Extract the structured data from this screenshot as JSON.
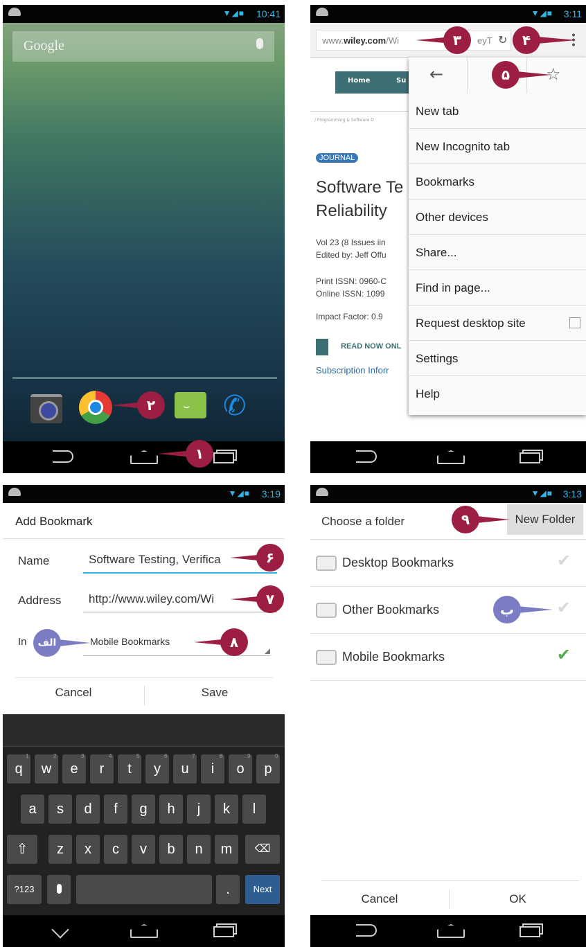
{
  "p1": {
    "time": "10:41",
    "search_label": "Google",
    "dock_icons": [
      "camera-icon",
      "chrome-icon",
      "messaging-icon",
      "phone-icon"
    ],
    "callouts": {
      "c1": "١",
      "c2": "٢"
    }
  },
  "p2": {
    "time": "3:11",
    "url_prefix": "www.",
    "url_domain": "wiley.com",
    "url_rest": "/Wi",
    "url_tail": "eyT",
    "site_nav": [
      "Home",
      "Su"
    ],
    "breadcrumb": "/ Programming & Software D",
    "journal_badge": "JOURNAL",
    "title_line1": "Software Te",
    "title_line2": "Reliability",
    "vol": "Vol 23 (8 Issues iin",
    "edited": "Edited by: Jeff Offu",
    "print_issn": "Print ISSN: 0960-C",
    "online_issn": "Online ISSN: 1099",
    "impact": "Impact Factor: 0.9",
    "read_now": "READ NOW ONL",
    "subscription": "Subscription Inforr",
    "menu": [
      "New tab",
      "New Incognito tab",
      "Bookmarks",
      "Other devices",
      "Share...",
      "Find in page...",
      "Request desktop site",
      "Settings",
      "Help"
    ],
    "callouts": {
      "c3": "٣",
      "c4": "۴",
      "c5": "۵"
    }
  },
  "p3": {
    "time": "3:19",
    "dialog_title": "Add Bookmark",
    "name_label": "Name",
    "name_value": "Software Testing, Verifica",
    "address_label": "Address",
    "address_value": "http://www.wiley.com/Wi",
    "in_label": "In",
    "folder_value": "Mobile Bookmarks",
    "cancel": "Cancel",
    "save": "Save",
    "row1": [
      "q",
      "w",
      "e",
      "r",
      "t",
      "y",
      "u",
      "i",
      "o",
      "p"
    ],
    "row1_hints": [
      "1",
      "2",
      "3",
      "4",
      "5",
      "6",
      "7",
      "8",
      "9",
      "0"
    ],
    "row2": [
      "a",
      "s",
      "d",
      "f",
      "g",
      "h",
      "j",
      "k",
      "l"
    ],
    "row3": [
      "z",
      "x",
      "c",
      "v",
      "b",
      "n",
      "m"
    ],
    "sym": "?123",
    "period": ".",
    "next": "Next",
    "callouts": {
      "c6": "۶",
      "c7": "٧",
      "c8": "٨",
      "ca": "الف"
    }
  },
  "p4": {
    "time": "3:13",
    "title": "Choose a folder",
    "new_folder": "New Folder",
    "folders": [
      "Desktop Bookmarks",
      "Other Bookmarks",
      "Mobile Bookmarks"
    ],
    "cancel": "Cancel",
    "ok": "OK",
    "callouts": {
      "c9": "٩",
      "cb": "ب"
    },
    "colors": {
      "selected_check": "#4caf50",
      "unselected_check": "#d8d8d8"
    }
  }
}
